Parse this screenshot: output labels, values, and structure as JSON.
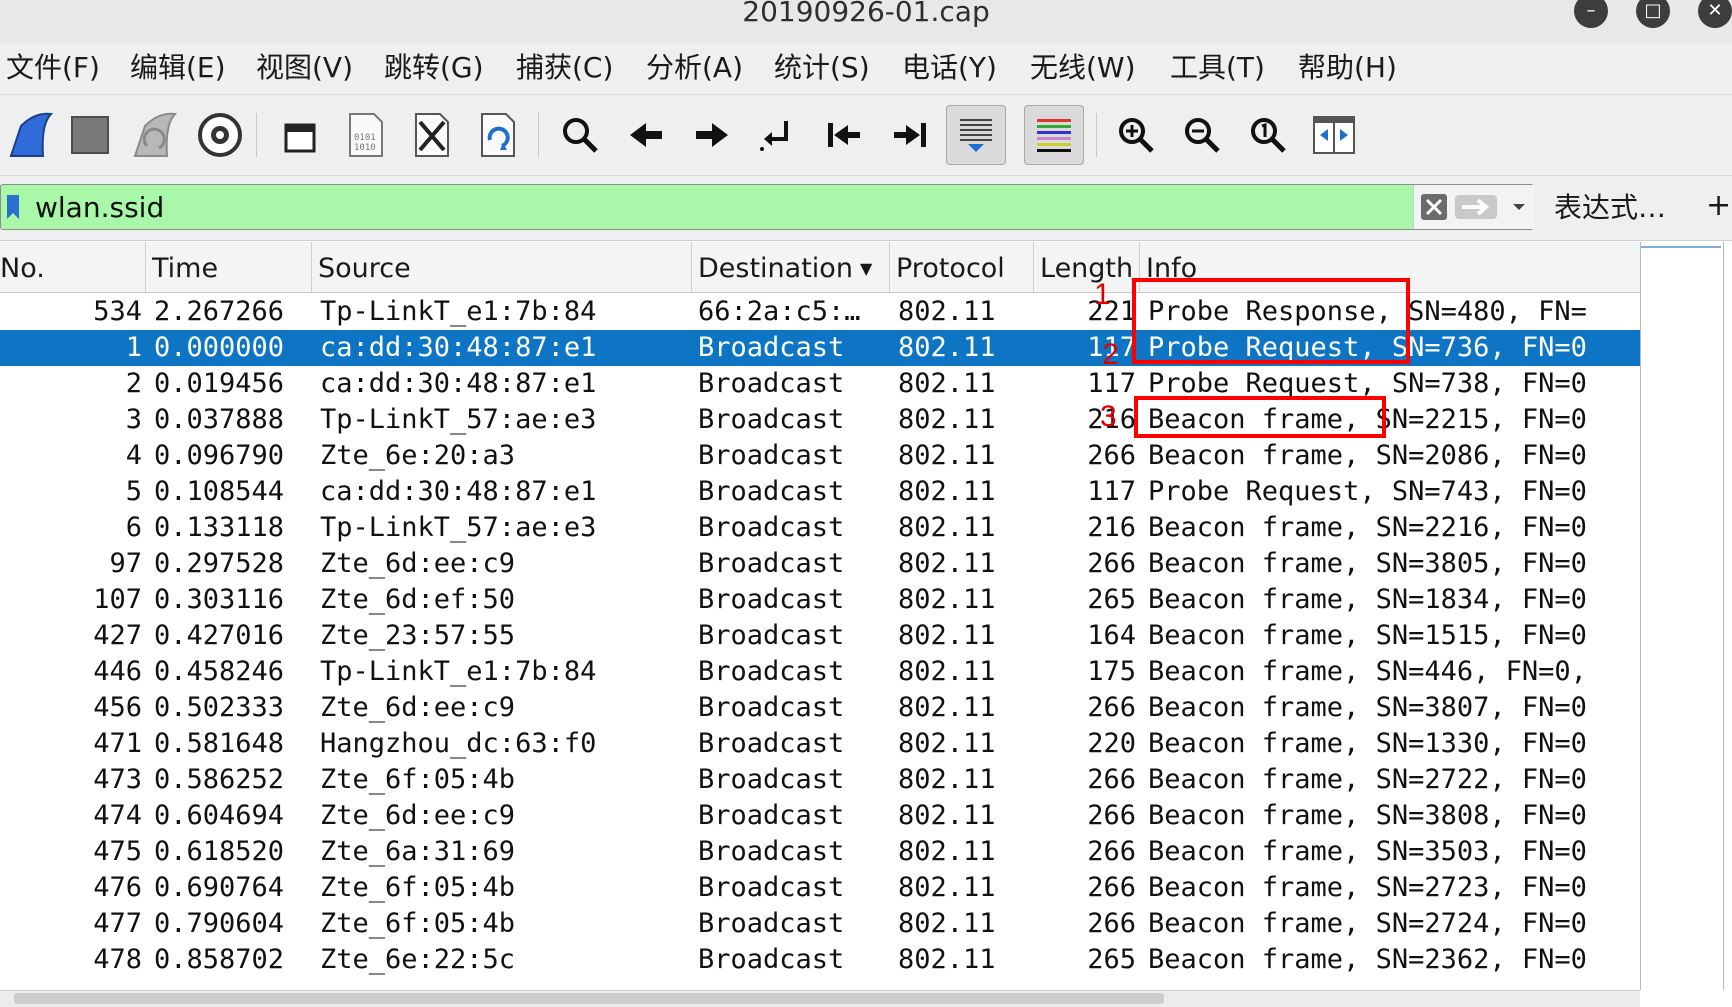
{
  "window": {
    "title": "20190926-01.cap"
  },
  "menubar": {
    "items": [
      "文件(F)",
      "编辑(E)",
      "视图(V)",
      "跳转(G)",
      "捕获(C)",
      "分析(A)",
      "统计(S)",
      "电话(Y)",
      "无线(W)",
      "工具(T)",
      "帮助(H)"
    ]
  },
  "toolbar": {
    "icons": [
      "shark-fin-start-icon",
      "stop-square-icon",
      "restart-fin-icon",
      "options-gear-icon",
      "open-file-icon",
      "file-binary-icon",
      "close-file-icon",
      "reload-file-icon",
      "search-icon",
      "back-arrow-icon",
      "forward-arrow-icon",
      "goto-packet-icon",
      "first-packet-icon",
      "last-packet-icon",
      "autoscroll-icon",
      "colorize-icon",
      "zoom-in-icon",
      "zoom-out-icon",
      "zoom-normal-icon",
      "resize-columns-icon"
    ]
  },
  "filter": {
    "value": "wlan.ssid",
    "expression_label": "表达式…",
    "add_label": "+"
  },
  "columns": [
    "No.",
    "Time",
    "Source",
    "Destination",
    "Protocol",
    "Length",
    "Info"
  ],
  "packets": [
    {
      "no": "534",
      "time": "2.267266",
      "source": "Tp-LinkT_e1:7b:84",
      "destination": "66:2a:c5:…",
      "protocol": "802.11",
      "length": "221",
      "info": "Probe Response, SN=480, FN="
    },
    {
      "no": "1",
      "time": "0.000000",
      "source": "ca:dd:30:48:87:e1",
      "destination": "Broadcast",
      "protocol": "802.11",
      "length": "117",
      "info": "Probe Request, SN=736, FN=0"
    },
    {
      "no": "2",
      "time": "0.019456",
      "source": "ca:dd:30:48:87:e1",
      "destination": "Broadcast",
      "protocol": "802.11",
      "length": "117",
      "info": "Probe Request, SN=738, FN=0"
    },
    {
      "no": "3",
      "time": "0.037888",
      "source": "Tp-LinkT_57:ae:e3",
      "destination": "Broadcast",
      "protocol": "802.11",
      "length": "216",
      "info": "Beacon frame, SN=2215, FN=0"
    },
    {
      "no": "4",
      "time": "0.096790",
      "source": "Zte_6e:20:a3",
      "destination": "Broadcast",
      "protocol": "802.11",
      "length": "266",
      "info": "Beacon frame, SN=2086, FN=0"
    },
    {
      "no": "5",
      "time": "0.108544",
      "source": "ca:dd:30:48:87:e1",
      "destination": "Broadcast",
      "protocol": "802.11",
      "length": "117",
      "info": "Probe Request, SN=743, FN=0"
    },
    {
      "no": "6",
      "time": "0.133118",
      "source": "Tp-LinkT_57:ae:e3",
      "destination": "Broadcast",
      "protocol": "802.11",
      "length": "216",
      "info": "Beacon frame, SN=2216, FN=0"
    },
    {
      "no": "97",
      "time": "0.297528",
      "source": "Zte_6d:ee:c9",
      "destination": "Broadcast",
      "protocol": "802.11",
      "length": "266",
      "info": "Beacon frame, SN=3805, FN=0"
    },
    {
      "no": "107",
      "time": "0.303116",
      "source": "Zte_6d:ef:50",
      "destination": "Broadcast",
      "protocol": "802.11",
      "length": "265",
      "info": "Beacon frame, SN=1834, FN=0"
    },
    {
      "no": "427",
      "time": "0.427016",
      "source": "Zte_23:57:55",
      "destination": "Broadcast",
      "protocol": "802.11",
      "length": "164",
      "info": "Beacon frame, SN=1515, FN=0"
    },
    {
      "no": "446",
      "time": "0.458246",
      "source": "Tp-LinkT_e1:7b:84",
      "destination": "Broadcast",
      "protocol": "802.11",
      "length": "175",
      "info": "Beacon frame, SN=446, FN=0,"
    },
    {
      "no": "456",
      "time": "0.502333",
      "source": "Zte_6d:ee:c9",
      "destination": "Broadcast",
      "protocol": "802.11",
      "length": "266",
      "info": "Beacon frame, SN=3807, FN=0"
    },
    {
      "no": "471",
      "time": "0.581648",
      "source": "Hangzhou_dc:63:f0",
      "destination": "Broadcast",
      "protocol": "802.11",
      "length": "220",
      "info": "Beacon frame, SN=1330, FN=0"
    },
    {
      "no": "473",
      "time": "0.586252",
      "source": "Zte_6f:05:4b",
      "destination": "Broadcast",
      "protocol": "802.11",
      "length": "266",
      "info": "Beacon frame, SN=2722, FN=0"
    },
    {
      "no": "474",
      "time": "0.604694",
      "source": "Zte_6d:ee:c9",
      "destination": "Broadcast",
      "protocol": "802.11",
      "length": "266",
      "info": "Beacon frame, SN=3808, FN=0"
    },
    {
      "no": "475",
      "time": "0.618520",
      "source": "Zte_6a:31:69",
      "destination": "Broadcast",
      "protocol": "802.11",
      "length": "266",
      "info": "Beacon frame, SN=3503, FN=0"
    },
    {
      "no": "476",
      "time": "0.690764",
      "source": "Zte_6f:05:4b",
      "destination": "Broadcast",
      "protocol": "802.11",
      "length": "266",
      "info": "Beacon frame, SN=2723, FN=0"
    },
    {
      "no": "477",
      "time": "0.790604",
      "source": "Zte_6f:05:4b",
      "destination": "Broadcast",
      "protocol": "802.11",
      "length": "266",
      "info": "Beacon frame, SN=2724, FN=0"
    },
    {
      "no": "478",
      "time": "0.858702",
      "source": "Zte_6e:22:5c",
      "destination": "Broadcast",
      "protocol": "802.11",
      "length": "265",
      "info": "Beacon frame, SN=2362, FN=0"
    }
  ],
  "selected_row_index": 1,
  "annotations": [
    "1",
    "2",
    "3"
  ],
  "colors": {
    "filter_background": "#a9f7a8",
    "selection": "#0d75c4",
    "annotation": "#ff0000"
  }
}
